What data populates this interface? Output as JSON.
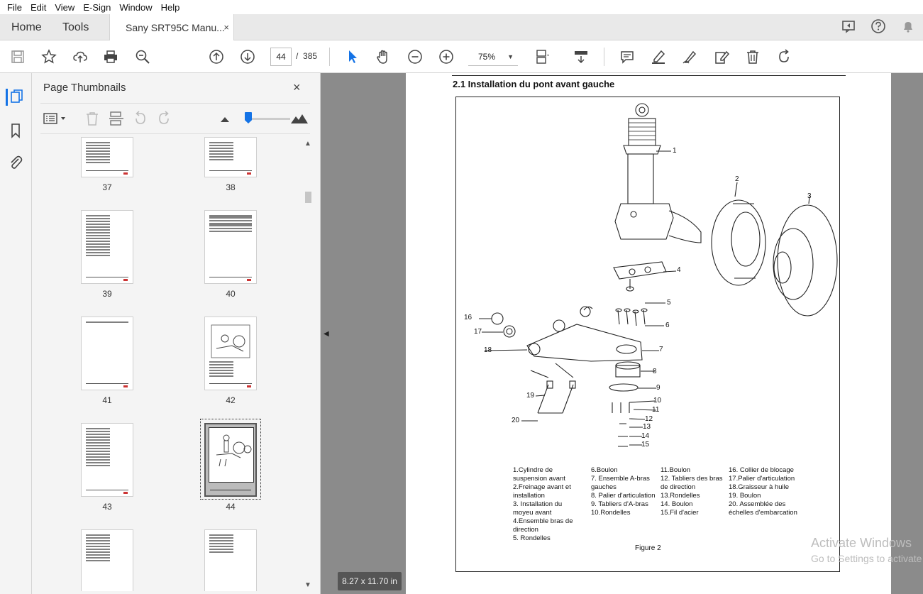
{
  "menu": [
    "File",
    "Edit",
    "View",
    "E-Sign",
    "Window",
    "Help"
  ],
  "tabs": {
    "home": "Home",
    "tools": "Tools",
    "document": "Sany SRT95C Manu...",
    "close": "×"
  },
  "toolbar": {
    "current_page": "44",
    "page_separator": "/",
    "total_pages": "385",
    "zoom": "75%"
  },
  "thumbnails_panel": {
    "title": "Page Thumbnails",
    "close": "×",
    "pages": [
      "37",
      "38",
      "39",
      "40",
      "41",
      "42",
      "43",
      "44"
    ],
    "selected_page": "44"
  },
  "document": {
    "heading": "2.1 Installation du pont avant gauche",
    "callouts": [
      "1",
      "2",
      "3",
      "4",
      "5",
      "6",
      "7",
      "8",
      "9",
      "10",
      "11",
      "12",
      "13",
      "14",
      "15",
      "16",
      "17",
      "18",
      "19",
      "20"
    ],
    "legend_col1": [
      "1.Cylindre de suspension avant",
      "2.Freinage avant et installation",
      "3. Installation du moyeu avant",
      "4.Ensemble bras de direction",
      "5. Rondelles"
    ],
    "legend_col2": [
      "6.Boulon",
      "7. Ensemble A-bras gauches",
      "8. Palier d'articulation",
      "9. Tabliers d'A-bras",
      "10.Rondelles"
    ],
    "legend_col3": [
      "11.Boulon",
      "12. Tabliers des bras de direction",
      "13.Rondelles",
      "14. Boulon",
      "15.Fil d'acier"
    ],
    "legend_col4": [
      "16. Collier de blocage",
      "17.Palier d'articulation",
      "18.Graisseur à huile",
      "19. Boulon",
      "20. Assemblée des échelles d'embarcation"
    ],
    "figure_caption": "Figure 2",
    "page_size": "8.27 x 11.70 in"
  },
  "watermark": {
    "line1": "Activate Windows",
    "line2": "Go to Settings to activate Windows."
  },
  "colors": {
    "accent": "#1473e6",
    "doc_background": "#8b8b8b"
  }
}
